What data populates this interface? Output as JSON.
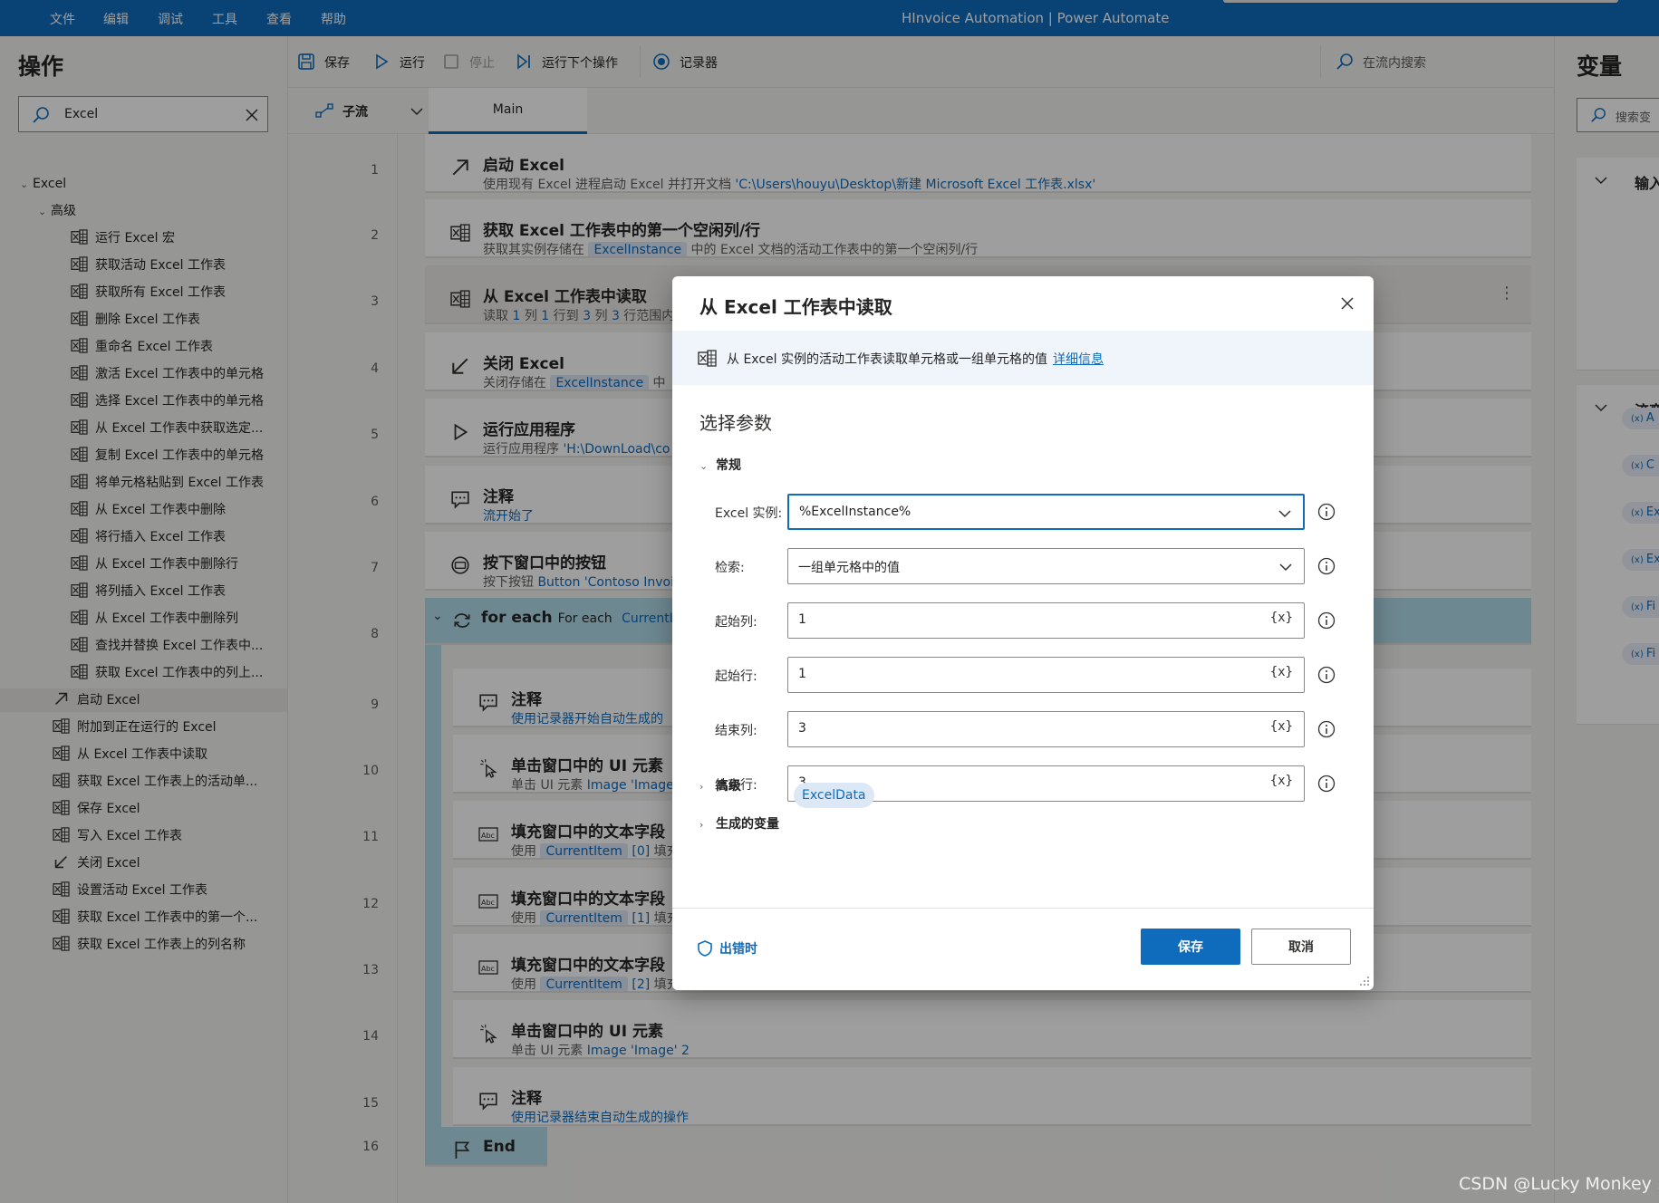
{
  "menu": {
    "items": [
      "文件",
      "编辑",
      "调试",
      "工具",
      "查看",
      "帮助"
    ],
    "title": "HInvoice Automation | Power Automate"
  },
  "left": {
    "title": "操作",
    "search_value": "Excel",
    "tree": [
      {
        "label": "Excel",
        "level": 0,
        "chev": true
      },
      {
        "label": "高级",
        "level": 1,
        "chev": true
      },
      {
        "label": "运行 Excel 宏",
        "level": 2,
        "icon": "excel"
      },
      {
        "label": "获取活动 Excel 工作表",
        "level": 2,
        "icon": "excel"
      },
      {
        "label": "获取所有 Excel 工作表",
        "level": 2,
        "icon": "excel"
      },
      {
        "label": "删除 Excel 工作表",
        "level": 2,
        "icon": "excel"
      },
      {
        "label": "重命名 Excel 工作表",
        "level": 2,
        "icon": "excel"
      },
      {
        "label": "激活 Excel 工作表中的单元格",
        "level": 2,
        "icon": "excel"
      },
      {
        "label": "选择 Excel 工作表中的单元格",
        "level": 2,
        "icon": "excel"
      },
      {
        "label": "从 Excel 工作表中获取选定...",
        "level": 2,
        "icon": "excel"
      },
      {
        "label": "复制 Excel 工作表中的单元格",
        "level": 2,
        "icon": "excel"
      },
      {
        "label": "将单元格粘贴到 Excel 工作表",
        "level": 2,
        "icon": "excel"
      },
      {
        "label": "从 Excel 工作表中删除",
        "level": 2,
        "icon": "excel"
      },
      {
        "label": "将行插入 Excel 工作表",
        "level": 2,
        "icon": "excel"
      },
      {
        "label": "从 Excel 工作表中删除行",
        "level": 2,
        "icon": "excel"
      },
      {
        "label": "将列插入 Excel 工作表",
        "level": 2,
        "icon": "excel"
      },
      {
        "label": "从 Excel 工作表中删除列",
        "level": 2,
        "icon": "excel"
      },
      {
        "label": "查找并替换 Excel 工作表中...",
        "level": 2,
        "icon": "excel"
      },
      {
        "label": "获取 Excel 工作表中的列上...",
        "level": 2,
        "icon": "excel"
      },
      {
        "label": "启动 Excel",
        "level": 1,
        "icon": "launch",
        "selected": true
      },
      {
        "label": "附加到正在运行的 Excel",
        "level": 1,
        "icon": "excel"
      },
      {
        "label": "从 Excel 工作表中读取",
        "level": 1,
        "icon": "excel"
      },
      {
        "label": "获取 Excel 工作表上的活动单...",
        "level": 1,
        "icon": "excel"
      },
      {
        "label": "保存 Excel",
        "level": 1,
        "icon": "excel"
      },
      {
        "label": "写入 Excel 工作表",
        "level": 1,
        "icon": "excel"
      },
      {
        "label": "关闭 Excel",
        "level": 1,
        "icon": "close"
      },
      {
        "label": "设置活动 Excel 工作表",
        "level": 1,
        "icon": "excel"
      },
      {
        "label": "获取 Excel 工作表中的第一个...",
        "level": 1,
        "icon": "excel"
      },
      {
        "label": "获取 Excel 工作表上的列名称",
        "level": 1,
        "icon": "excel"
      }
    ]
  },
  "toolbar": {
    "save": "保存",
    "run": "运行",
    "stop": "停止",
    "run_next": "运行下个操作",
    "recorder": "记录器",
    "search_placeholder": "在流内搜索"
  },
  "tabs": {
    "subflow": "子流",
    "main": "Main"
  },
  "flow": {
    "line_numbers": [
      "1",
      "2",
      "3",
      "4",
      "5",
      "6",
      "7",
      "8",
      "9",
      "10",
      "11",
      "12",
      "13",
      "14",
      "15",
      "16"
    ],
    "steps": [
      {
        "title": "启动 Excel",
        "desc": [
          {
            "t": "使用现有 Excel 进程启动 Excel 并打开文档 "
          },
          {
            "t": "'C:\\Users\\houyu\\Desktop\\新建 Microsoft Excel 工作表.xlsx'",
            "k": "tok"
          }
        ],
        "icon": "launch"
      },
      {
        "title": "获取 Excel 工作表中的第一个空闲列/行",
        "desc": [
          {
            "t": "获取其实例存储在 "
          },
          {
            "t": "ExcelInstance",
            "k": "pill"
          },
          {
            "t": " 中的 Excel 文档的活动工作表中的第一个空闲列/行"
          }
        ],
        "icon": "excel"
      },
      {
        "title": "从 Excel 工作表中读取",
        "desc": [
          {
            "t": "读取 "
          },
          {
            "t": "1",
            "k": "tok"
          },
          {
            "t": " 列 "
          },
          {
            "t": "1",
            "k": "tok"
          },
          {
            "t": " 行到 "
          },
          {
            "t": "3",
            "k": "tok"
          },
          {
            "t": " 列 "
          },
          {
            "t": "3",
            "k": "tok"
          },
          {
            "t": " 行范围内"
          }
        ],
        "icon": "excel"
      },
      {
        "title": "关闭 Excel",
        "desc": [
          {
            "t": "关闭存储在 "
          },
          {
            "t": "ExcelInstance",
            "k": "pill"
          },
          {
            "t": " 中"
          }
        ],
        "icon": "close"
      },
      {
        "title": "运行应用程序",
        "desc": [
          {
            "t": "运行应用程序 "
          },
          {
            "t": "'H:\\DownLoad\\co",
            "k": "tok"
          }
        ],
        "icon": "play"
      },
      {
        "title": "注释",
        "desc": [
          {
            "t": "流开始了",
            "k": "tok"
          }
        ],
        "icon": "comment"
      },
      {
        "title": "按下窗口中的按钮",
        "desc": [
          {
            "t": "按下按钮 "
          },
          {
            "t": "Button 'Contoso Invoi",
            "k": "tok"
          }
        ],
        "icon": "press"
      },
      {
        "title": "for each",
        "desc": [],
        "icon": "loop",
        "suffix": [
          {
            "t": "For each "
          },
          {
            "t": "CurrentIter",
            "k": "tok"
          }
        ]
      },
      {
        "title": "注释",
        "desc": [
          {
            "t": "使用记录器开始自动生成的",
            "k": "tok"
          }
        ],
        "icon": "comment"
      },
      {
        "title": "单击窗口中的 UI 元素",
        "desc": [
          {
            "t": "单击 UI 元素 "
          },
          {
            "t": "Image 'Image",
            "k": "tok"
          }
        ],
        "icon": "click"
      },
      {
        "title": "填充窗口中的文本字段",
        "desc": [
          {
            "t": "使用 "
          },
          {
            "t": "CurrentItem",
            "k": "pill"
          },
          {
            "t": " "
          },
          {
            "t": "[0]",
            "k": "tok"
          },
          {
            "t": " 填充"
          }
        ],
        "icon": "abc"
      },
      {
        "title": "填充窗口中的文本字段",
        "desc": [
          {
            "t": "使用 "
          },
          {
            "t": "CurrentItem",
            "k": "pill"
          },
          {
            "t": " "
          },
          {
            "t": "[1]",
            "k": "tok"
          },
          {
            "t": " 填充"
          }
        ],
        "icon": "abc"
      },
      {
        "title": "填充窗口中的文本字段",
        "desc": [
          {
            "t": "使用 "
          },
          {
            "t": "CurrentItem",
            "k": "pill"
          },
          {
            "t": " "
          },
          {
            "t": "[2]",
            "k": "tok"
          },
          {
            "t": " 填充"
          }
        ],
        "icon": "abc"
      },
      {
        "title": "单击窗口中的 UI 元素",
        "desc": [
          {
            "t": "单击 UI 元素 "
          },
          {
            "t": "Image 'Image' 2",
            "k": "tok"
          }
        ],
        "icon": "click"
      },
      {
        "title": "注释",
        "desc": [
          {
            "t": "使用记录器结束自动生成的操作",
            "k": "tok"
          }
        ],
        "icon": "comment"
      },
      {
        "title": "End",
        "desc": [],
        "icon": "flag"
      }
    ]
  },
  "right": {
    "title": "变量",
    "search_placeholder": "搜索变",
    "sec1": "输入",
    "sec2": "流变",
    "pills": [
      "A",
      "C",
      "Ex",
      "Ex",
      "Fi",
      "Fi"
    ]
  },
  "dialog": {
    "title": "从 Excel 工作表中读取",
    "info": "从 Excel 实例的活动工作表读取单元格或一组单元格的值",
    "info_link": "详细信息",
    "subtitle": "选择参数",
    "section_general": "常规",
    "fields": [
      {
        "label": "Excel 实例:",
        "value": "%ExcelInstance%",
        "type": "dropdown"
      },
      {
        "label": "检索:",
        "value": "一组单元格中的值",
        "type": "dropdown"
      },
      {
        "label": "起始列:",
        "value": "1",
        "type": "text"
      },
      {
        "label": "起始行:",
        "value": "1",
        "type": "text"
      },
      {
        "label": "结束列:",
        "value": "3",
        "type": "text"
      },
      {
        "label": "结束行:",
        "value": "3",
        "type": "text"
      }
    ],
    "var_btn": "{x}",
    "section_advanced": "高级",
    "section_vars": "生成的变量",
    "var_pill": "ExcelData",
    "on_error": "出错时",
    "save": "保存",
    "cancel": "取消"
  },
  "watermark": "CSDN @Lucky Monkey ."
}
